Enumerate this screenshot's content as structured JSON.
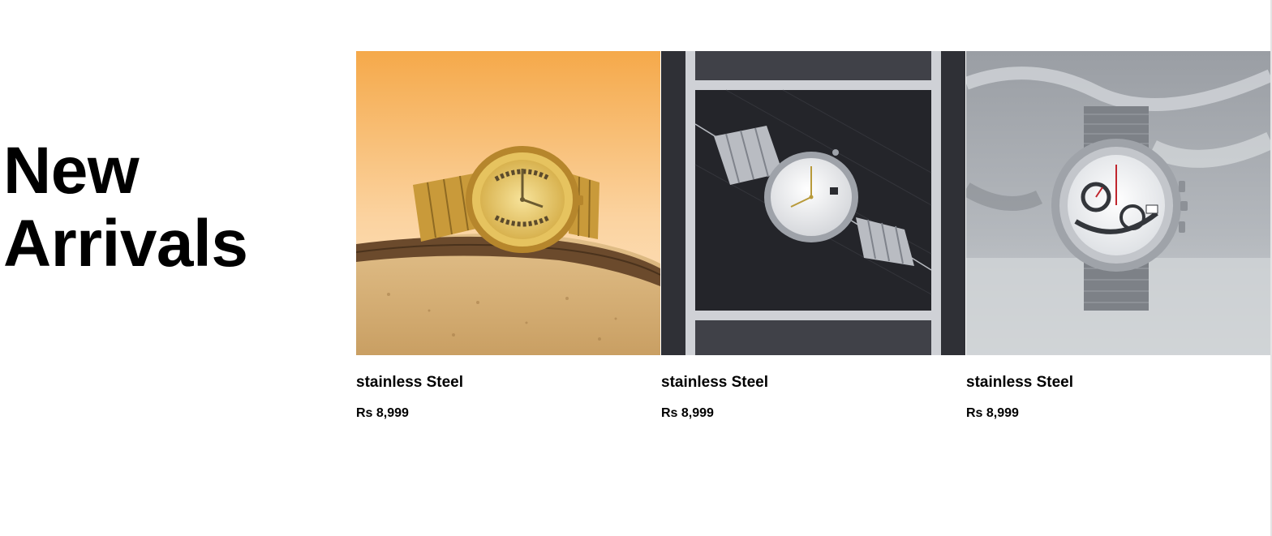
{
  "section": {
    "title_line1": "New",
    "title_line2": "Arrivals"
  },
  "products": [
    {
      "name": "stainless Steel",
      "price": "Rs 8,999",
      "image": "gold-watch-on-sand"
    },
    {
      "name": "stainless Steel",
      "price": "Rs 8,999",
      "image": "silver-watch-in-dark-box"
    },
    {
      "name": "stainless Steel",
      "price": "Rs 8,999",
      "image": "silver-chronograph-mesh-strap"
    }
  ]
}
